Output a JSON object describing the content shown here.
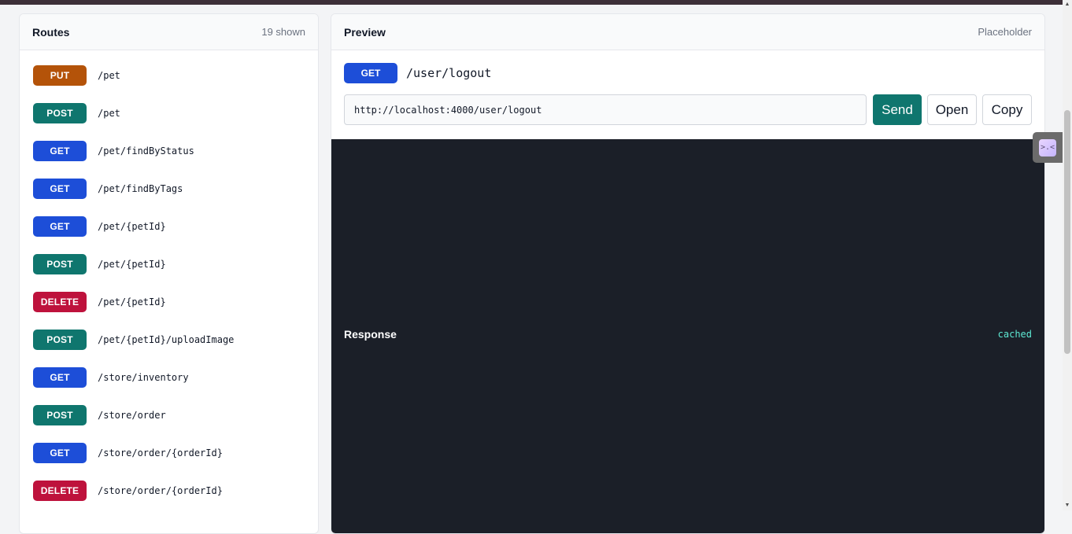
{
  "routes_panel": {
    "title": "Routes",
    "count_label": "19 shown",
    "items": [
      {
        "method": "PUT",
        "path": "/pet",
        "color": "#b45309"
      },
      {
        "method": "POST",
        "path": "/pet",
        "color": "#0f766e"
      },
      {
        "method": "GET",
        "path": "/pet/findByStatus",
        "color": "#1d4ed8"
      },
      {
        "method": "GET",
        "path": "/pet/findByTags",
        "color": "#1d4ed8"
      },
      {
        "method": "GET",
        "path": "/pet/{petId}",
        "color": "#1d4ed8"
      },
      {
        "method": "POST",
        "path": "/pet/{petId}",
        "color": "#0f766e"
      },
      {
        "method": "DELETE",
        "path": "/pet/{petId}",
        "color": "#be123c"
      },
      {
        "method": "POST",
        "path": "/pet/{petId}/uploadImage",
        "color": "#0f766e"
      },
      {
        "method": "GET",
        "path": "/store/inventory",
        "color": "#1d4ed8"
      },
      {
        "method": "POST",
        "path": "/store/order",
        "color": "#0f766e"
      },
      {
        "method": "GET",
        "path": "/store/order/{orderId}",
        "color": "#1d4ed8"
      },
      {
        "method": "DELETE",
        "path": "/store/order/{orderId}",
        "color": "#be123c"
      }
    ]
  },
  "preview_panel": {
    "title": "Preview",
    "meta_label": "Placeholder",
    "request": {
      "method": "GET",
      "method_color": "#1d4ed8",
      "path": "/user/logout",
      "url": "http://localhost:4000/user/logout"
    },
    "buttons": {
      "send": "Send",
      "open": "Open",
      "copy": "Copy"
    },
    "response": {
      "label": "Response",
      "status": "cached"
    }
  },
  "side_handle": {
    "glyph": ">.<"
  },
  "scrollbar": {
    "up_arrow": "▲",
    "down_arrow": "▼"
  },
  "colors": {
    "accent": "#0f766e",
    "get": "#1d4ed8",
    "post": "#0f766e",
    "put": "#b45309",
    "delete": "#be123c",
    "response_bg": "#1b1f28"
  }
}
